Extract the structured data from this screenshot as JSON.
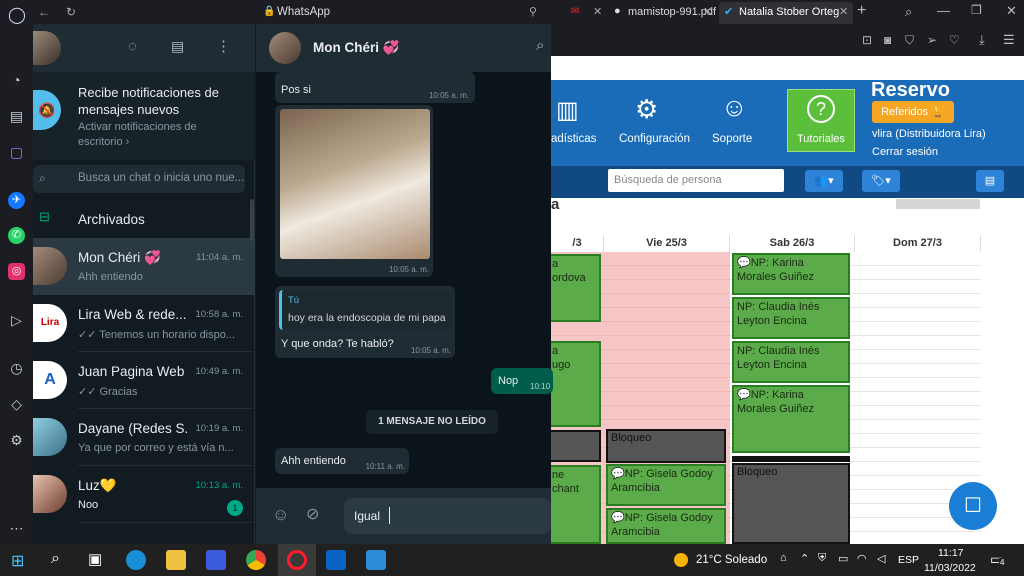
{
  "browser": {
    "tabs": [
      {
        "label": "WhatsApp"
      },
      {
        "label": "mamistop-991.pdf"
      },
      {
        "label": "Natalia Stober Orteg"
      }
    ]
  },
  "whatsapp": {
    "notification": {
      "title": "Recibe notificaciones de mensajes nuevos",
      "subtitle": "Activar notificaciones de escritorio ›"
    },
    "search_placeholder": "Busca un chat o inicia uno nue...",
    "archived_label": "Archivados",
    "chats": [
      {
        "name": "Mon Chéri 💞",
        "time": "11:04 a. m.",
        "preview": "Ahh entiendo"
      },
      {
        "name": "Lira Web & rede...",
        "time": "10:58 a. m.",
        "preview": "✓✓ Tenemos un horario dispo..."
      },
      {
        "name": "Juan Pagina Web",
        "time": "10:49 a. m.",
        "preview": "✓✓ Gracias"
      },
      {
        "name": "Dayane (Redes S...",
        "time": "10:19 a. m.",
        "preview": "Ya que por correo y está vía n..."
      },
      {
        "name": "Luz💛",
        "time": "10:13 a. m.",
        "preview": "Noo",
        "unread": "1"
      }
    ],
    "conversation": {
      "contact_name": "Mon Chéri 💞",
      "messages": [
        {
          "text": "Pos si",
          "time": "10:05 a. m."
        },
        {
          "time": "10:05 a. m."
        },
        {
          "quote_author": "Tú",
          "quote_text": "hoy era la endoscopia de mi papa",
          "text": "Y que onda? Te habló?",
          "time": "10:05 a. m."
        },
        {
          "text": "Nop",
          "time": "10:10"
        },
        {
          "text": "Ahh entiendo",
          "time": "10:11 a. m."
        }
      ],
      "unread_divider": "1 MENSAJE NO LEÍDO",
      "input_value": "Igual"
    }
  },
  "reservo": {
    "logo": "Reservo",
    "nav": [
      {
        "label": "adísticas"
      },
      {
        "label": "Configuración"
      },
      {
        "label": "Soporte"
      },
      {
        "label": "Tutoriales"
      }
    ],
    "referidos": "Referidos 🏆",
    "user": "vlira (Distribuidora Lira)",
    "logout": "Cerrar sesión",
    "search_placeholder": "Búsqueda de persona",
    "partial_title": "a",
    "days": [
      "/3",
      "Vie 25/3",
      "Sab 26/3",
      "Dom 27/3"
    ],
    "events_col0": [
      "a",
      "ordova",
      "a",
      "ugo",
      "ne",
      "chant"
    ],
    "events_fri": [
      "Bloqueo",
      "💬NP: Gisela Godoy Aramcibia",
      "💬NP: Gisela Godoy Aramcibia"
    ],
    "events_sat": [
      "💬NP: Karina Morales Guiñez",
      "NP: Claudia Inés Leyton Encina",
      "NP: Claudia Inés Leyton Encina",
      "💬NP: Karina Morales Guiñez",
      "Bloqueo"
    ]
  },
  "taskbar": {
    "weather": "21°C Soleado",
    "lang": "ESP",
    "time": "11:17",
    "date": "11/03/2022",
    "notif_count": "4"
  },
  "colors": {
    "wa_bg": "#111b21",
    "reservo_blue": "#1a6bb8",
    "event_green": "#5cab4b",
    "block_pink": "#f6c6c6"
  }
}
